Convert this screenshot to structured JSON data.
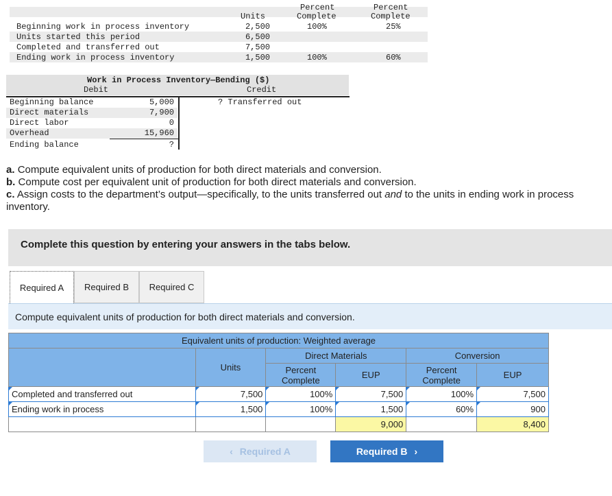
{
  "top_table": {
    "headers": {
      "units": "Units",
      "pct_dm_partial": "Percent",
      "pct_dm": "Complete",
      "pct_conv_partial": "Percent",
      "pct_conv": "Complete"
    },
    "rows": [
      {
        "label": "Beginning work in process inventory",
        "units": "2,500",
        "dm": "100%",
        "conv": "25%"
      },
      {
        "label": "Units started this period",
        "units": "6,500",
        "dm": "",
        "conv": ""
      },
      {
        "label": "Completed and transferred out",
        "units": "7,500",
        "dm": "",
        "conv": ""
      },
      {
        "label": "Ending work in process inventory",
        "units": "1,500",
        "dm": "100%",
        "conv": "60%"
      }
    ]
  },
  "t_account": {
    "title": "Work in Process Inventory—Bending ($)",
    "debit": "Debit",
    "credit": "Credit",
    "rows": [
      {
        "label": "Beginning balance",
        "value": "5,000"
      },
      {
        "label": "Direct materials",
        "value": "7,900"
      },
      {
        "label": "Direct labor",
        "value": "0"
      },
      {
        "label": "Overhead",
        "value": "15,960"
      }
    ],
    "ending_label": "Ending balance",
    "ending_value": "?",
    "credit_entry": "? Transferred out"
  },
  "questions": {
    "a_prefix": "a.",
    "a_text": "Compute equivalent units of production for both direct materials and conversion.",
    "b_prefix": "b.",
    "b_text": "Compute cost per equivalent unit of production for both direct materials and conversion.",
    "c_prefix": "c.",
    "c_text_1": "Assign costs to the department’s output—specifically, to the units transferred out ",
    "c_text_and": "and",
    "c_text_2": " to the units in ending work in process",
    "c_text_3": "inventory."
  },
  "banner": "Complete this question by entering your answers in the tabs below.",
  "tabs": [
    "Required A",
    "Required B",
    "Required C"
  ],
  "instruction": "Compute equivalent units of production for both direct materials and conversion.",
  "eup_table": {
    "title": "Equivalent units of production: Weighted average",
    "dm_header": "Direct Materials",
    "conv_header": "Conversion",
    "units_header": "Units",
    "pct_header_1": "Percent",
    "pct_header_2": "Complete",
    "eup_header": "EUP",
    "rows": [
      {
        "label": "Completed and transferred out",
        "units": "7,500",
        "dm_pct": "100%",
        "dm_eup": "7,500",
        "conv_pct": "100%",
        "conv_eup": "7,500"
      },
      {
        "label": "Ending work in process",
        "units": "1,500",
        "dm_pct": "100%",
        "dm_eup": "1,500",
        "conv_pct": "60%",
        "conv_eup": "900"
      }
    ],
    "total_dm_eup": "9,000",
    "total_conv_eup": "8,400"
  },
  "nav": {
    "prev_label": "Required A",
    "next_label": "Required B"
  },
  "colors": {
    "header_blue": "#7fb3e8",
    "total_yellow": "#fbf8a4",
    "next_button": "#3276c3"
  }
}
